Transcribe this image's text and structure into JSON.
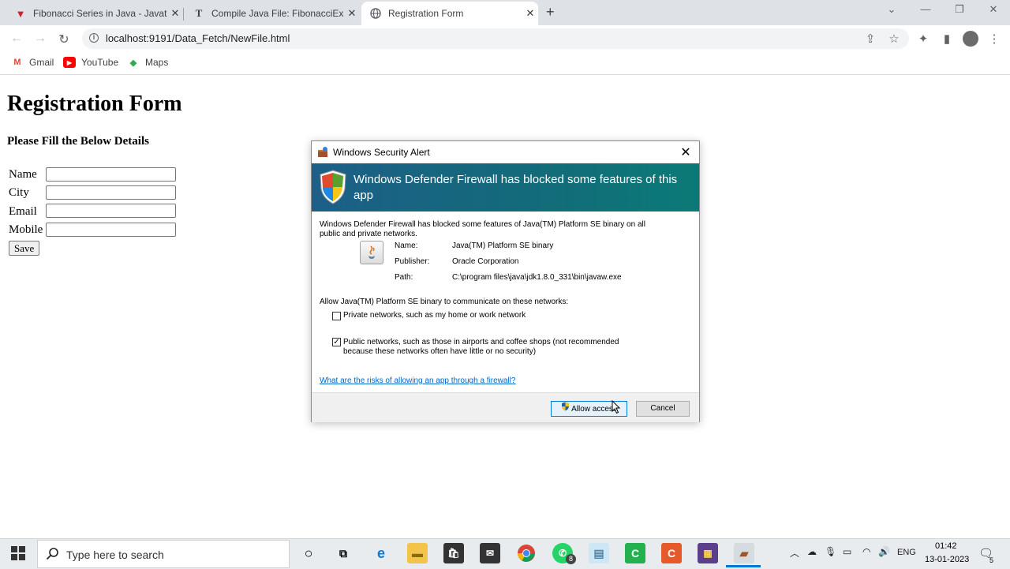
{
  "browser": {
    "tabs": [
      {
        "title": "Fibonacci Series in Java - Javatpc",
        "favicon": "V",
        "active": false
      },
      {
        "title": "Compile Java File: FibonacciExam",
        "favicon": "T",
        "active": false
      },
      {
        "title": "Registration Form",
        "favicon": "globe",
        "active": true
      }
    ],
    "url": "localhost:9191/Data_Fetch/NewFile.html",
    "bookmarks": [
      {
        "label": "Gmail",
        "icon": "gmail-icon"
      },
      {
        "label": "YouTube",
        "icon": "youtube-icon"
      },
      {
        "label": "Maps",
        "icon": "maps-icon"
      }
    ]
  },
  "page": {
    "title": "Registration Form",
    "subtitle": "Please Fill the Below Details",
    "fields": [
      {
        "label": "Name",
        "value": ""
      },
      {
        "label": "City",
        "value": ""
      },
      {
        "label": "Email",
        "value": ""
      },
      {
        "label": "Mobile",
        "value": ""
      }
    ],
    "save_label": "Save"
  },
  "dialog": {
    "title": "Windows Security Alert",
    "banner": "Windows Defender Firewall has blocked some features of this app",
    "description": "Windows Defender Firewall has blocked some features of Java(TM) Platform SE binary on all public and private networks.",
    "name_label": "Name:",
    "name_value": "Java(TM) Platform SE binary",
    "publisher_label": "Publisher:",
    "publisher_value": "Oracle Corporation",
    "path_label": "Path:",
    "path_value": "C:\\program files\\java\\jdk1.8.0_331\\bin\\javaw.exe",
    "allow_prompt": "Allow Java(TM) Platform SE binary to communicate on these networks:",
    "private_label": "Private networks, such as my home or work network",
    "private_checked": false,
    "public_label": "Public networks, such as those in airports and coffee shops (not recommended because these networks often have little or no security)",
    "public_checked": true,
    "link": "What are the risks of allowing an app through a firewall?",
    "allow_button": "Allow access",
    "cancel_button": "Cancel"
  },
  "taskbar": {
    "search_placeholder": "Type here to search",
    "whatsapp_badge": "8",
    "lang": "ENG",
    "time": "01:42",
    "date": "13-01-2023",
    "notification_count": "5"
  },
  "colors": {
    "banner_start": "#1d5f88",
    "banner_end": "#0b7a77",
    "link": "#0066cc",
    "tab_active_bg": "#ffffff",
    "tabstrip_bg": "#dee1e6"
  }
}
